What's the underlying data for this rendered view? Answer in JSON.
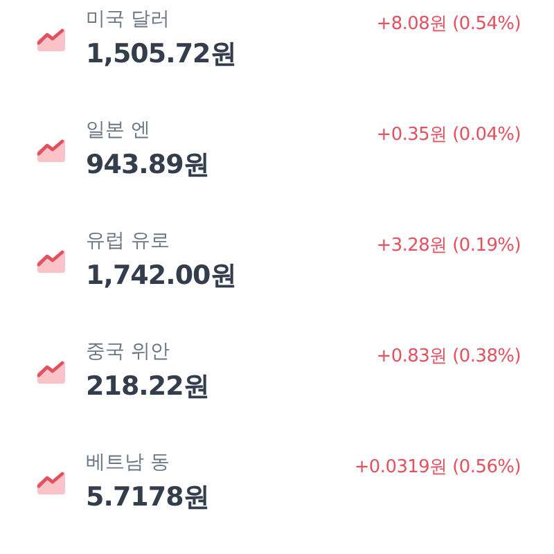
{
  "currencies": [
    {
      "name": "미국 달러",
      "price": "1,505.72원",
      "change": "+8.08원 (0.54%)",
      "kind": "up"
    },
    {
      "name": "일본 엔",
      "price": "943.89원",
      "change": "+0.35원 (0.04%)",
      "kind": "up"
    },
    {
      "name": "유럽 유로",
      "price": "1,742.00원",
      "change": "+3.28원 (0.19%)",
      "kind": "up"
    },
    {
      "name": "중국 위안",
      "price": "218.22원",
      "change": "+0.83원 (0.38%)",
      "kind": "up"
    },
    {
      "name": "베트남 동",
      "price": "5.7178원",
      "change": "+0.0319원 (0.56%)",
      "kind": "up"
    }
  ]
}
